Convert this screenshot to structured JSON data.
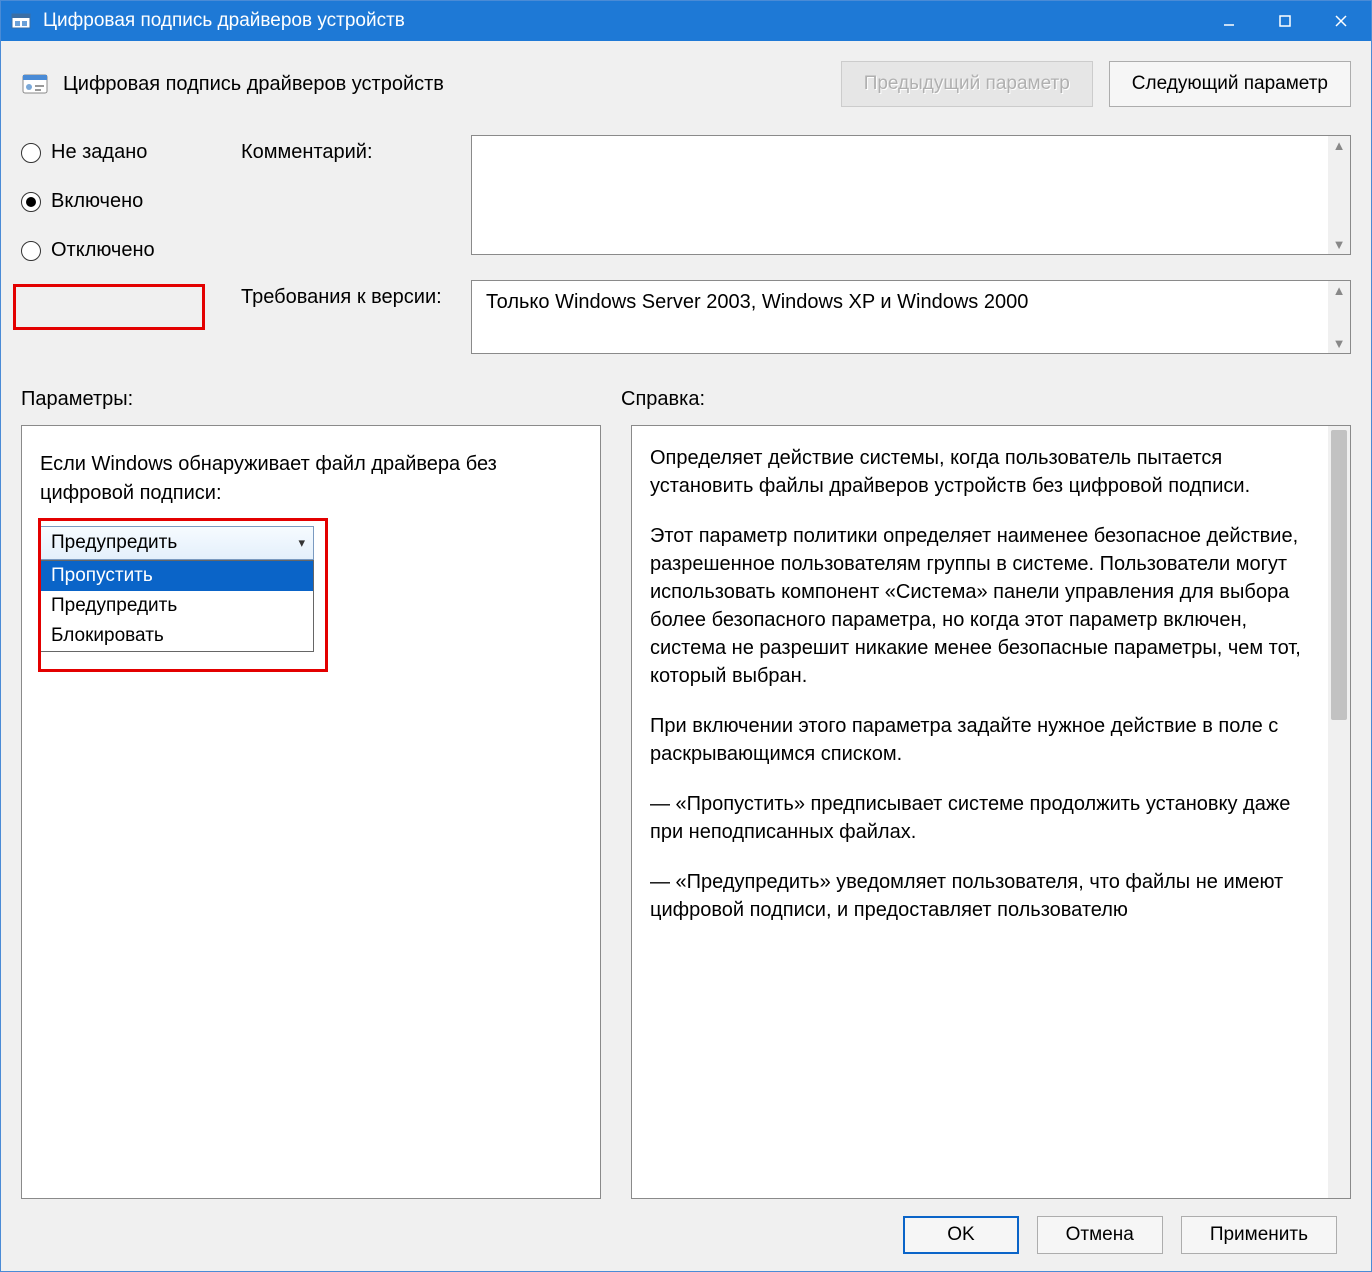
{
  "window": {
    "title": "Цифровая подпись драйверов устройств"
  },
  "policy": {
    "title": "Цифровая подпись драйверов устройств"
  },
  "nav": {
    "prev": "Предыдущий параметр",
    "next": "Следующий параметр"
  },
  "radios": {
    "not_configured": "Не задано",
    "enabled": "Включено",
    "disabled": "Отключено"
  },
  "labels": {
    "comment": "Комментарий:",
    "requirements": "Требования к версии:",
    "parameters": "Параметры:",
    "help": "Справка:"
  },
  "requirements_text": "Только Windows Server 2003, Windows XP и Windows 2000",
  "param_prompt": "Если Windows обнаруживает файл драйвера без цифровой подписи:",
  "combo": {
    "selected": "Предупредить",
    "options": [
      "Пропустить",
      "Предупредить",
      "Блокировать"
    ]
  },
  "help": {
    "p1": "Определяет действие системы, когда пользователь пытается установить файлы драйверов устройств без цифровой подписи.",
    "p2": "Этот параметр политики определяет наименее безопасное действие, разрешенное пользователям группы в системе. Пользователи могут использовать компонент «Система» панели управления для выбора более безопасного параметра, но когда этот параметр включен, система не разрешит никакие менее безопасные параметры, чем тот, который выбран.",
    "p3": "При включении этого параметра задайте нужное действие в поле с раскрывающимся списком.",
    "p4": "— «Пропустить» предписывает системе продолжить установку даже при неподписанных файлах.",
    "p5": "— «Предупредить» уведомляет пользователя, что файлы не имеют цифровой подписи, и предоставляет пользователю"
  },
  "footer": {
    "ok": "OK",
    "cancel": "Отмена",
    "apply": "Применить"
  }
}
